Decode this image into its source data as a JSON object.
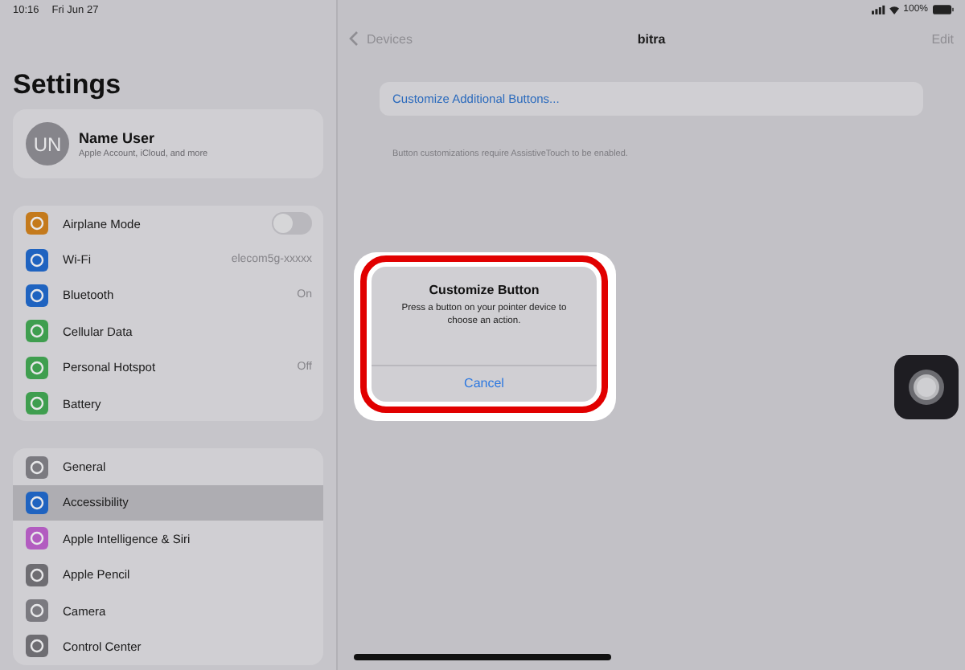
{
  "status_bar": {
    "time": "10:16",
    "date": "Fri Jun 27",
    "battery": "100%"
  },
  "sidebar": {
    "title": "Settings",
    "profile": {
      "initials": "UN",
      "name": "Name User",
      "subtitle": "Apple Account, iCloud, and more"
    },
    "groups": [
      [
        {
          "label": "Airplane Mode",
          "kind": "toggle",
          "on": false,
          "selected": false,
          "color": "#c47a1c"
        },
        {
          "label": "Wi-Fi",
          "kind": "value",
          "value": "elecom5g-xxxxx",
          "selected": false,
          "color": "#1f63c0"
        },
        {
          "label": "Bluetooth",
          "kind": "value",
          "value": "On",
          "selected": false,
          "color": "#1f63c0"
        },
        {
          "label": "Cellular Data",
          "kind": "plain",
          "selected": false,
          "color": "#3f9e4f"
        },
        {
          "label": "Personal Hotspot",
          "kind": "value",
          "value": "Off",
          "selected": false,
          "color": "#3f9e4f"
        },
        {
          "label": "Battery",
          "kind": "plain",
          "selected": false,
          "color": "#3f9e4f"
        }
      ],
      [
        {
          "label": "General",
          "kind": "plain",
          "selected": false,
          "color": "#7b7a80"
        },
        {
          "label": "Accessibility",
          "kind": "plain",
          "selected": true,
          "color": "#1f63c0"
        },
        {
          "label": "Apple Intelligence & Siri",
          "kind": "plain",
          "selected": false,
          "color": "#b25cc0"
        },
        {
          "label": "Apple Pencil",
          "kind": "plain",
          "selected": false,
          "color": "#6e6d72"
        },
        {
          "label": "Camera",
          "kind": "plain",
          "selected": false,
          "color": "#7b7a80"
        },
        {
          "label": "Control Center",
          "kind": "plain",
          "selected": false,
          "color": "#6e6d72"
        }
      ]
    ]
  },
  "detail": {
    "back_label": "Devices",
    "title": "bitra",
    "action": "Edit",
    "button_label": "Customize Additional Buttons...",
    "footnote": "Button customizations require AssistiveTouch to be enabled."
  },
  "alert": {
    "title": "Customize Button",
    "message": "Press a button on your pointer device to choose an action.",
    "cancel": "Cancel",
    "highlighted": true
  }
}
